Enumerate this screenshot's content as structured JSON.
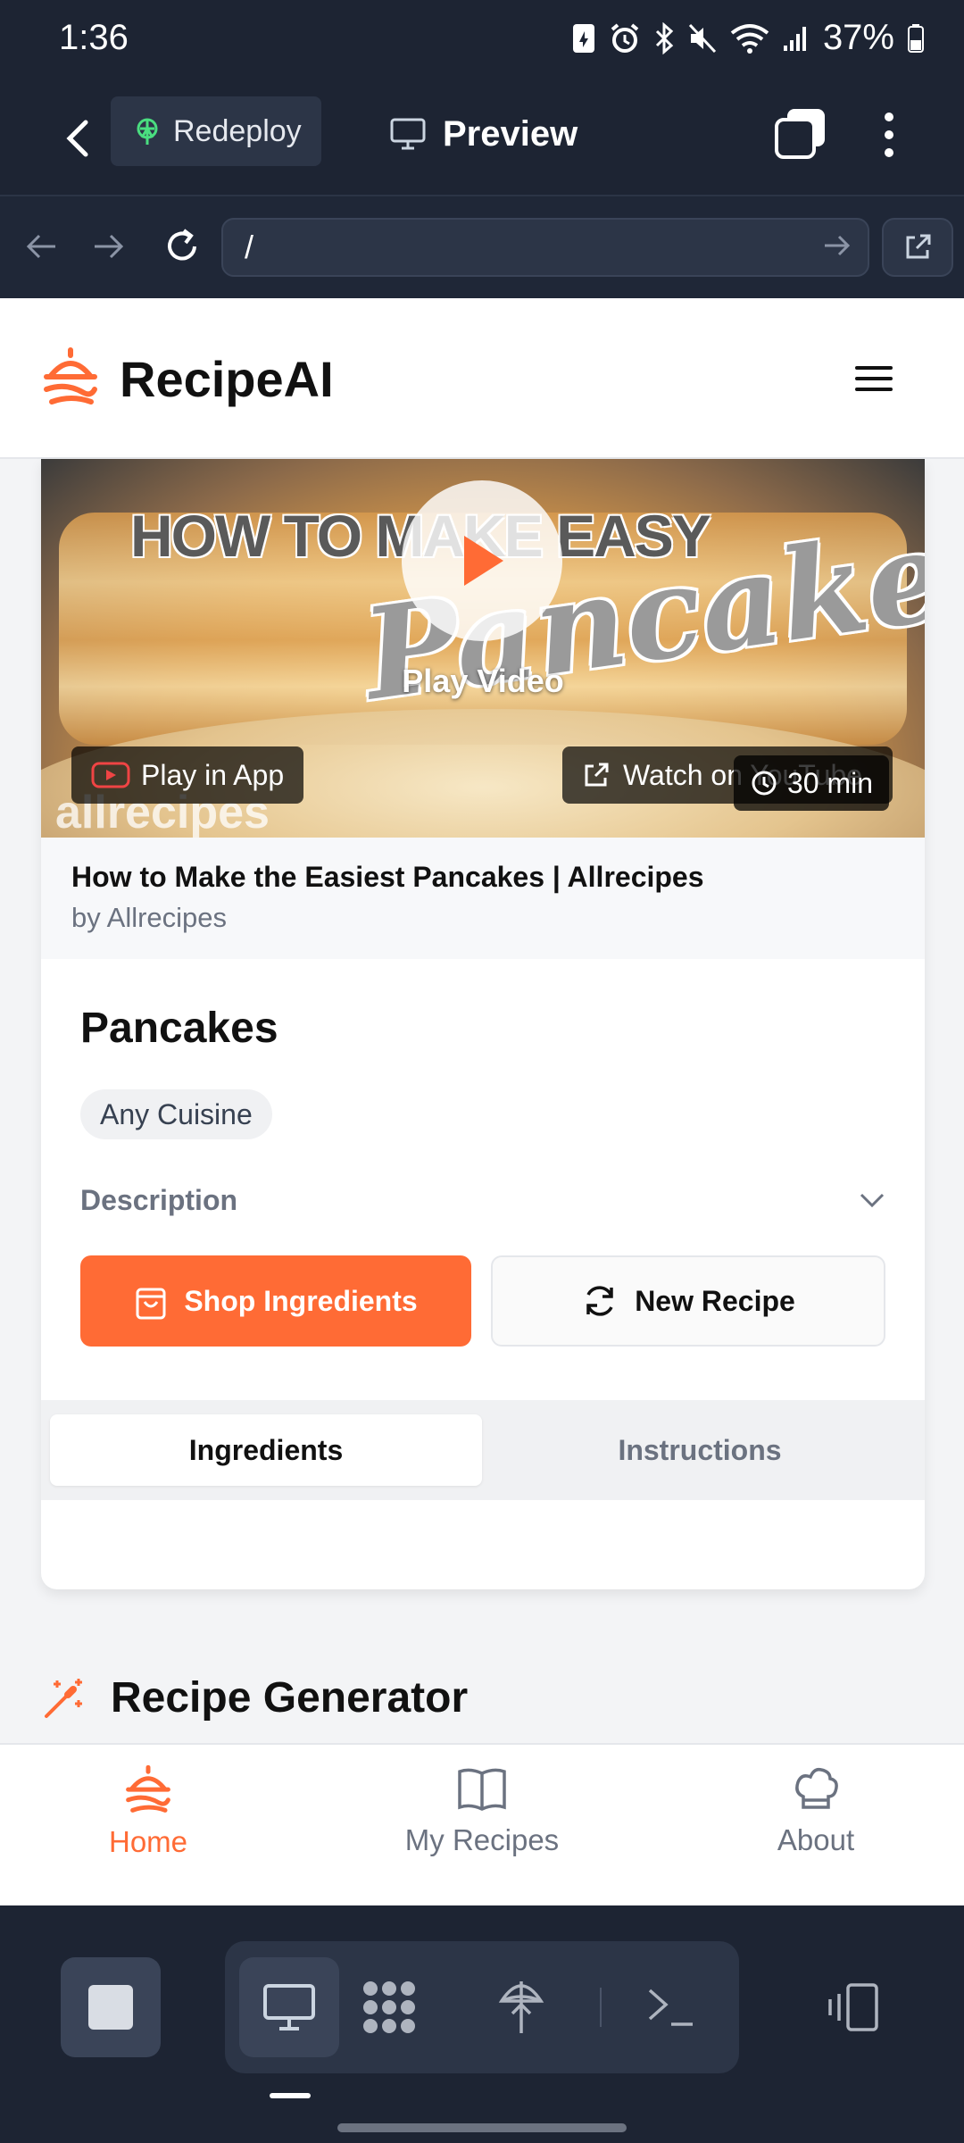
{
  "status_bar": {
    "time": "1:36",
    "battery": "37%"
  },
  "top_bar": {
    "redeploy_label": "Redeploy",
    "preview_label": "Preview"
  },
  "browser": {
    "url": "/"
  },
  "site": {
    "brand": "RecipeAI"
  },
  "video": {
    "thumb_title": "HOW TO MAKE EASY",
    "thumb_script": "Pancakes",
    "thumb_watermark": "allrecipes",
    "play_label": "Play Video",
    "play_in_app": "Play in App",
    "watch_youtube": "Watch on YouTube",
    "duration": "30 min",
    "title": "How to Make the Easiest Pancakes | Allrecipes",
    "author": "by Allrecipes"
  },
  "recipe": {
    "name": "Pancakes",
    "cuisine": "Any Cuisine",
    "description_label": "Description",
    "shop_label": "Shop Ingredients",
    "new_recipe_label": "New Recipe",
    "tabs": [
      {
        "label": "Ingredients"
      },
      {
        "label": "Instructions"
      }
    ]
  },
  "generator": {
    "heading": "Recipe Generator"
  },
  "bottom_nav": [
    {
      "label": "Home"
    },
    {
      "label": "My Recipes"
    },
    {
      "label": "About"
    }
  ],
  "colors": {
    "accent": "#ff6b35",
    "dark": "#1d2433",
    "muted": "#6b7280"
  }
}
